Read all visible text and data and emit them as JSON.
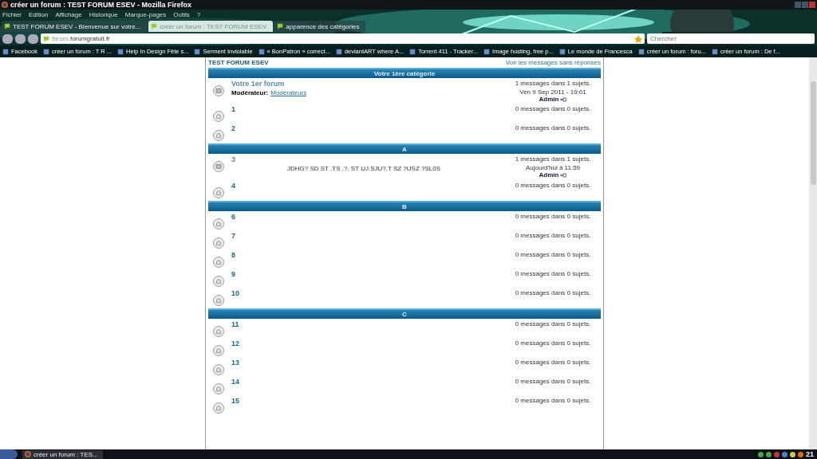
{
  "window": {
    "title": "créer un forum : TEST FORUM ESEV - Mozilla Firefox"
  },
  "menu": [
    "Fichier",
    "Edition",
    "Affichage",
    "Historique",
    "Marque-pages",
    "Outils",
    "?"
  ],
  "tabs": [
    {
      "label": "TEST FORUM ESEV - Bienvenue sur votre...",
      "selected": false
    },
    {
      "label": "créer un forum : TEST FORUM ESEV",
      "selected": true
    },
    {
      "label": "apparence des catégories",
      "selected": false
    }
  ],
  "address": {
    "prefix": "ttesev.",
    "domain": "forumgratuit.fr"
  },
  "search": {
    "placeholder": "Chercher"
  },
  "bookmarks": [
    "Facebook",
    "créer un forum : T R ...",
    "Help In Design Fête s...",
    "Serment Inviolable",
    "« BonPatron » correct...",
    "deviantART where A...",
    "Torrent 411 - Tracker...",
    "Image hosting, free p...",
    "Le monde de Francesca",
    "créer un forum : foru...",
    "créer un forum : De f..."
  ],
  "forum": {
    "title": "TEST FORUM ESEV",
    "unanswered_link": "Voir les messages sans réponses",
    "categories": [
      {
        "title": "Votre 1ère catégorie",
        "forums": [
          {
            "name": "Votre 1er forum",
            "new_posts": true,
            "moderator_label": "Modérateur:",
            "moderator": "Modérateurs",
            "stats": "1 messages dans 1 sujets.",
            "last_date": "Ven 9 Sep 2011 - 19:01",
            "last_user": "Admin"
          },
          {
            "name": "1",
            "new_posts": false,
            "stats": "0 messages dans 0 sujets."
          },
          {
            "name": "2",
            "new_posts": false,
            "stats": "0 messages dans 0 sujets."
          }
        ]
      },
      {
        "title": "A",
        "forums": [
          {
            "name": "3",
            "new_posts": true,
            "description": "JDHG? SD ST .TS .?. ST UJ.SJU?.T SZ ?USZ ?SL0S",
            "stats": "1 messages dans 1 sujets.",
            "last_date": "Aujourd'hui à 11:59",
            "last_user": "Admin"
          },
          {
            "name": "4",
            "new_posts": false,
            "stats": "0 messages dans 0 sujets."
          }
        ]
      },
      {
        "title": "B",
        "forums": [
          {
            "name": "6",
            "new_posts": false,
            "stats": "0 messages dans 0 sujets."
          },
          {
            "name": "7",
            "new_posts": false,
            "stats": "0 messages dans 0 sujets."
          },
          {
            "name": "8",
            "new_posts": false,
            "stats": "0 messages dans 0 sujets."
          },
          {
            "name": "9",
            "new_posts": false,
            "stats": "0 messages dans 0 sujets."
          },
          {
            "name": "10",
            "new_posts": false,
            "stats": "0 messages dans 0 sujets."
          }
        ]
      },
      {
        "title": "C",
        "forums": [
          {
            "name": "11",
            "new_posts": false,
            "stats": "0 messages dans 0 sujets."
          },
          {
            "name": "12",
            "new_posts": false,
            "stats": "0 messages dans 0 sujets."
          },
          {
            "name": "13",
            "new_posts": false,
            "stats": "0 messages dans 0 sujets."
          },
          {
            "name": "14",
            "new_posts": false,
            "stats": "0 messages dans 0 sujets."
          },
          {
            "name": "15",
            "new_posts": false,
            "stats": "0 messages dans 0 sujets."
          }
        ]
      }
    ]
  },
  "taskbar": {
    "task": "créer un forum : TES...",
    "clock": "21"
  }
}
